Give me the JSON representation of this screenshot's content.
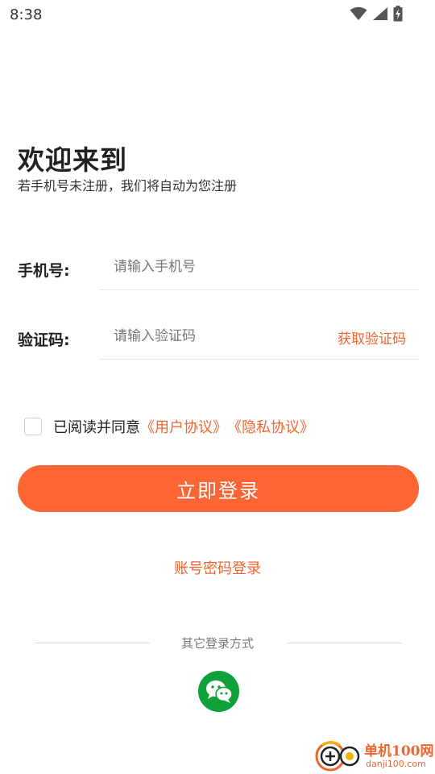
{
  "status_bar": {
    "time": "8:38"
  },
  "header": {
    "title": "欢迎来到",
    "subtitle": "若手机号未注册，我们将自动为您注册"
  },
  "form": {
    "phone_label": "手机号:",
    "phone_placeholder": "请输入手机号",
    "phone_value": "",
    "code_label": "验证码:",
    "code_placeholder": "请输入验证码",
    "code_value": "",
    "get_code_label": "获取验证码"
  },
  "agreement": {
    "checked": false,
    "text": "已阅读并同意",
    "user_agreement": "《用户协议》",
    "privacy_policy": "《隐私协议》"
  },
  "login_button": "立即登录",
  "password_login": "账号密码登录",
  "other_login": {
    "label": "其它登录方式",
    "methods": [
      "wechat-icon"
    ]
  },
  "watermark": {
    "name": "单机100网",
    "url": "danji100.com"
  },
  "colors": {
    "accent": "#fd6535",
    "link": "#f0642e",
    "wechat": "#10a13a"
  }
}
